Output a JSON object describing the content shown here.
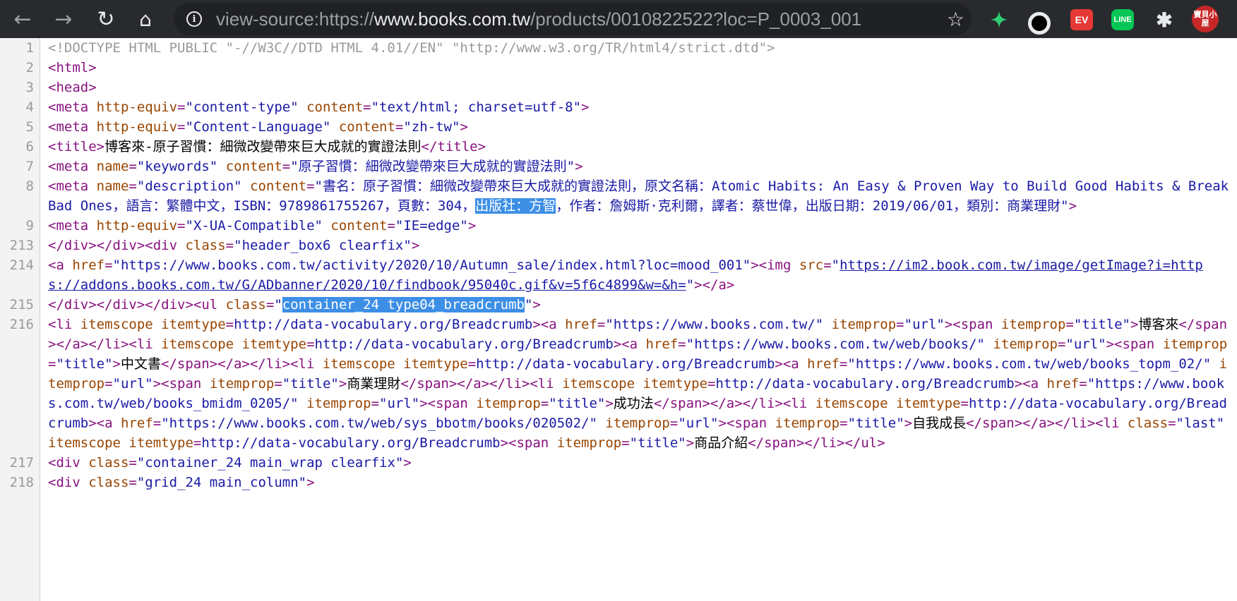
{
  "browser": {
    "url_prefix": "view-source:https://",
    "url_host": "www.books.com.tw",
    "url_path": "/products/0010822522?loc=P_0003_001",
    "extensions": [
      "feedly-icon",
      "circle-icon",
      "ev-icon",
      "line-icon",
      "puzzle-icon",
      "treasure-house-icon"
    ],
    "ext_labels": {
      "ev": "EV",
      "line": "LINE",
      "six": "寶貝小屋"
    }
  },
  "source": {
    "l1": {
      "n": "1",
      "doctype": "<!DOCTYPE HTML PUBLIC \"-//W3C//DTD HTML 4.01//EN\" \"http://www.w3.org/TR/html4/strict.dtd\">"
    },
    "l2": {
      "n": "2",
      "t1": "<html>"
    },
    "l3": {
      "n": "3",
      "t1": "<head>"
    },
    "l4": {
      "n": "4",
      "t1": "<meta ",
      "a1": "http-equiv",
      "v1": "\"content-type\"",
      "a2": " content",
      "v2": "\"text/html; charset=utf-8\"",
      "t2": ">"
    },
    "l5": {
      "n": "5",
      "t1": "<meta ",
      "a1": "http-equiv",
      "v1": "\"Content-Language\"",
      "a2": " content",
      "v2": "\"zh-tw\"",
      "t2": ">"
    },
    "l6": {
      "n": "6",
      "t1": "<title>",
      "text": "博客來-原子習慣：細微改變帶來巨大成就的實證法則",
      "t2": "</title>"
    },
    "l7": {
      "n": "7",
      "t1": "<meta ",
      "a1": "name",
      "v1": "\"keywords\"",
      "a2": " content",
      "v2": "\"原子習慣：細微改變帶來巨大成就的實證法則\"",
      "t2": ">"
    },
    "l8": {
      "n": "8",
      "t1": "<meta ",
      "a1": "name",
      "v1": "\"description\"",
      "a2": " content",
      "v2a": "\"書名：原子習慣：細微改變帶來巨大成就的實證法則，原文名稱：Atomic Habits: An Easy & Proven Way to Build Good Habits & Break Bad Ones，語言：繁體中文，ISBN：9789861755267，頁數：304，",
      "hl": "出版社：方智",
      "v2b": "，作者：詹姆斯·克利爾，譯者：蔡世偉，出版日期：2019/06/01，類別：商業理財\"",
      "t2": ">"
    },
    "l9": {
      "n": "9",
      "t1": "<meta ",
      "a1": "http-equiv",
      "v1": "\"X-UA-Compatible\"",
      "a2": " content",
      "v2": "\"IE=edge\"",
      "t2": ">"
    },
    "l213": {
      "n": "213",
      "t1": "</div></div><div ",
      "a1": "class",
      "v1": "\"header_box6 clearfix\"",
      "t2": ">"
    },
    "l214": {
      "n": "214",
      "t1": "<a ",
      "a1": "href",
      "v1": "\"https://www.books.com.tw/activity/2020/10/Autumn_sale/index.html?loc=mood_001\"",
      "t2": "><img ",
      "a2": "src",
      "q1": "\"",
      "link": "https://im2.book.com.tw/image/getImage?i=https://addons.books.com.tw/G/ADbanner/2020/10/findbook/95040c.gif&v=5f6c4899&w=&h=",
      "q2": "\"",
      "t3": "></a>"
    },
    "l215": {
      "n": "215",
      "t1": "</div></div></div><ul ",
      "a1": "class",
      "q1": "\"",
      "hl": "container_24 type04_breadcrumb",
      "q2": "\"",
      "t2": ">"
    },
    "l216": {
      "n": "216",
      "s1": "<li ",
      "s2": "itemscope itemtype",
      "s3": "http://data-vocabulary.org/Breadcrumb",
      "s4": "><a ",
      "s5": "href",
      "s6": "\"https://www.books.com.tw/\"",
      "s7": " itemprop",
      "s8": "\"url\"",
      "s9": "><span ",
      "s10": "itemprop",
      "s11": "\"title\"",
      "s12": ">",
      "x1": "博客來",
      "s13": "</span></a></li><li ",
      "s14": "itemscope itemtype",
      "s15": "http://data-vocabulary.org/Breadcrumb",
      "s16": "><a ",
      "s17": "href",
      "s18": "\"https://www.books.com.tw/web/books/\"",
      "s19": " itemprop",
      "s20": "\"url\"",
      "s21": "><span ",
      "s22": "itemprop",
      "s23": "\"title\"",
      "s24": ">",
      "x2": "中文書",
      "s25": "</span></a></li><li ",
      "s26": "itemscope itemtype",
      "s27": "http://data-vocabulary.org/Breadcrumb",
      "s28": "><a ",
      "s29": "href",
      "s30": "\"https://www.books.com.tw/web/books_topm_02/\"",
      "s31": " itemprop",
      "s32": "\"url\"",
      "s33": "><span ",
      "s34": "itemprop",
      "s35": "\"title\"",
      "s36": ">",
      "x3": "商業理財",
      "s37": "</span></a></li><li ",
      "s38": "itemscope itemtype",
      "s39": "http://data-vocabulary.org/Breadcrumb",
      "s40": "><a ",
      "s41": "href",
      "s42": "\"https://www.books.com.tw/web/books_bmidm_0205/\"",
      "s43": " itemprop",
      "s44": "\"url\"",
      "s45": "><span ",
      "s46": "itemprop",
      "s47": "\"title\"",
      "s48": ">",
      "x4": "成功法",
      "s49": "</span></a></li><li ",
      "s50": "itemscope itemtype",
      "s51": "http://data-vocabulary.org/Breadcrumb",
      "s52": "><a ",
      "s53": "href",
      "s54": "\"https://www.books.com.tw/web/sys_bbotm/books/020502/\"",
      "s55": " itemprop",
      "s56": "\"url\"",
      "s57": "><span ",
      "s58": "itemprop",
      "s59": "\"title\"",
      "s60": ">",
      "x5": "自我成長",
      "s61": "</span></a></li><li ",
      "s62": "class",
      "s63": "\"last\"",
      "s64": " itemscope itemtype",
      "s65": "http://data-vocabulary.org/Breadcrumb",
      "s66": "><span ",
      "s67": "itemprop",
      "s68": "\"title\"",
      "s69": ">",
      "x6": "商品介紹",
      "s70": "</span></li></ul>"
    },
    "l217": {
      "n": "217",
      "t1": "<div ",
      "a1": "class",
      "v1": "\"container_24 main_wrap clearfix\"",
      "t2": ">"
    },
    "l218": {
      "n": "218",
      "t1": "<div ",
      "a1": "class",
      "v1": "\"grid_24 main_column\"",
      "t2": ">"
    }
  }
}
